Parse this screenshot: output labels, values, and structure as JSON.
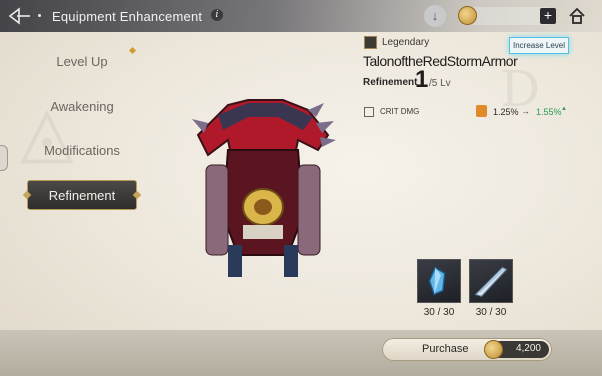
{
  "topbar": {
    "title": "Equipment Enhancement",
    "back_icon": "back-arrow-icon",
    "info_icon": "i",
    "download_icon": "↓",
    "plus_label": "+",
    "home_icon": "home-icon"
  },
  "menu": {
    "items": [
      {
        "label": "Level Up",
        "active": false
      },
      {
        "label": "Awakening",
        "active": false
      },
      {
        "label": "Modifications",
        "active": false
      },
      {
        "label": "Refinement",
        "active": true
      }
    ]
  },
  "item": {
    "grade": "Legendary",
    "name": "TalonoftheRedStormArmor",
    "refinement_label": "Refinement",
    "refinement_level": "1",
    "refinement_max": "/5 Lv",
    "increase_level_label": "Increase Level"
  },
  "stat": {
    "name": "CRIT DMG",
    "current": "1.25%",
    "arrow": "→",
    "next": "1.55%",
    "up_mark": "▲"
  },
  "materials": [
    {
      "name": "blue-crystal",
      "count": "30 / 30"
    },
    {
      "name": "silver-blade-shard",
      "count": "30 / 30"
    }
  ],
  "purchase": {
    "label": "Purchase",
    "price": "4,200"
  },
  "colors": {
    "accent_gold": "#c6a45a",
    "stat_up_green": "#2f9a55",
    "highlight_cyan": "#4fc2e2"
  }
}
